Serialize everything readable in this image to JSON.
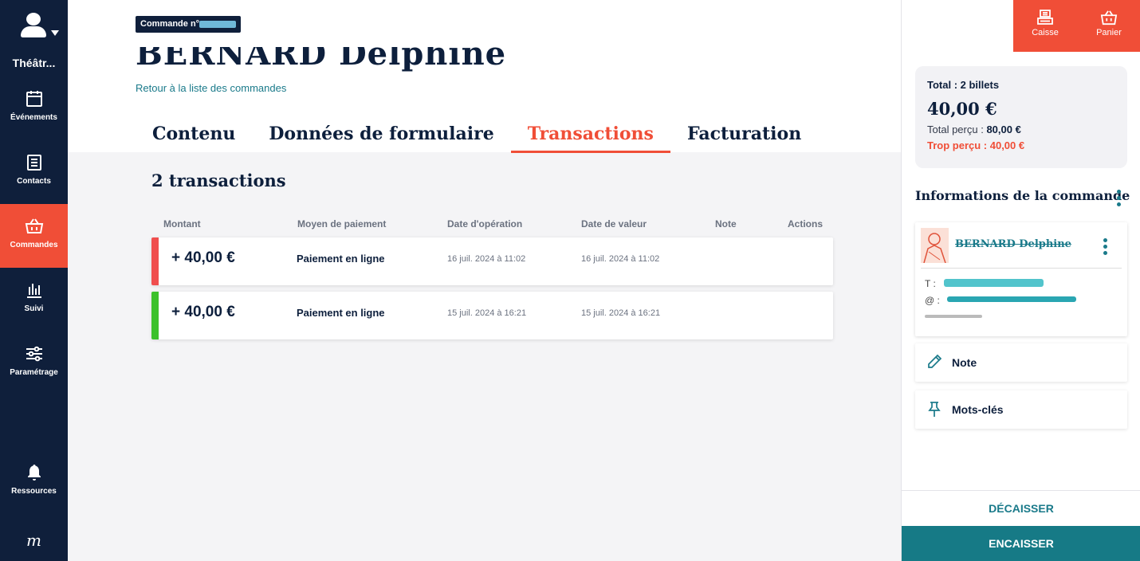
{
  "sidebar": {
    "venue": "Théâtr...",
    "items": [
      {
        "label": "Événements",
        "icon": "calendar-icon"
      },
      {
        "label": "Contacts",
        "icon": "contacts-icon"
      },
      {
        "label": "Commandes",
        "icon": "basket-icon",
        "active": true
      },
      {
        "label": "Suivi",
        "icon": "bar-chart-icon"
      },
      {
        "label": "Paramétrage",
        "icon": "sliders-icon"
      }
    ],
    "resources_label": "Ressources",
    "logo": "m"
  },
  "header": {
    "order_label": "Commande n°",
    "customer_name": "BERNARD Delphine",
    "back_link": "Retour à la liste des commandes",
    "tabs": [
      "Contenu",
      "Données de formulaire",
      "Transactions",
      "Facturation"
    ],
    "active_tab": "Transactions"
  },
  "transactions": {
    "count_label": "2 transactions",
    "columns": [
      "Montant",
      "Moyen de paiement",
      "Date d'opération",
      "Date de valeur",
      "Note",
      "Actions"
    ],
    "rows": [
      {
        "amount": "+ 40,00 €",
        "method": "Paiement en ligne",
        "op_date": "16 juil. 2024 à 11:02",
        "value_date": "16 juil. 2024 à 11:02",
        "status_color": "#f04e4e"
      },
      {
        "amount": "+ 40,00 €",
        "method": "Paiement en ligne",
        "op_date": "15 juil. 2024 à 16:21",
        "value_date": "15 juil. 2024 à 16:21",
        "status_color": "#3cc12c"
      }
    ]
  },
  "panel": {
    "caisse_label": "Caisse",
    "panier_label": "Panier",
    "total_label": "Total : 2 billets",
    "total_amount": "40,00 €",
    "received_label": "Total perçu :",
    "received_value": "80,00 €",
    "over_label": "Trop perçu : 40,00 €",
    "info_title": "Informations de la commande",
    "customer_name": "BERNARD Delphine",
    "phone_label": "T :",
    "email_label": "@ :",
    "note_label": "Note",
    "keywords_label": "Mots-clés",
    "decaisser_label": "DÉCAISSER",
    "encaisser_label": "ENCAISSER"
  },
  "colors": {
    "brand_red": "#f04e37",
    "navy": "#0f1f3b",
    "teal": "#167a86"
  }
}
